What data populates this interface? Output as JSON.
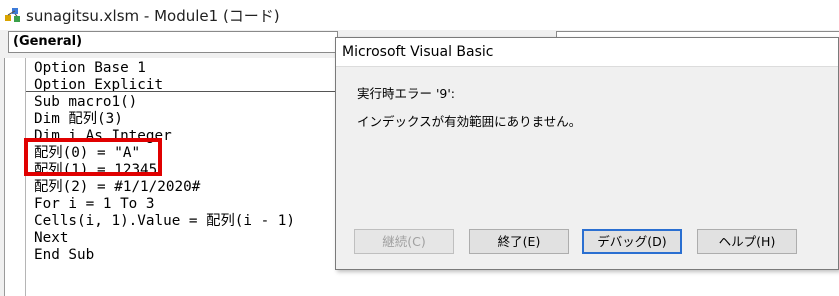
{
  "window": {
    "title": "sunagitsu.xlsm - Module1 (コード)",
    "icon": "vba-project-icon"
  },
  "combos": {
    "object_value": "(General)"
  },
  "code_lines": [
    "Option Base 1",
    "Option Explicit",
    "Sub macro1()",
    "Dim 配列(3)",
    "Dim i As Integer",
    "配列(0) = \"A\"",
    "配列(1) = 12345",
    "配列(2) = #1/1/2020#",
    "For i = 1 To 3",
    "Cells(i, 1).Value = 配列(i - 1)",
    "Next",
    "End Sub"
  ],
  "highlight_color": "#e00000",
  "dialog": {
    "title": "Microsoft Visual Basic",
    "error_line": "実行時エラー '9':",
    "message": "インデックスが有効範囲にありません。",
    "buttons": {
      "continue": "継続(C)",
      "end": "終了(E)",
      "debug": "デバッグ(D)",
      "help": "ヘルプ(H)"
    }
  }
}
